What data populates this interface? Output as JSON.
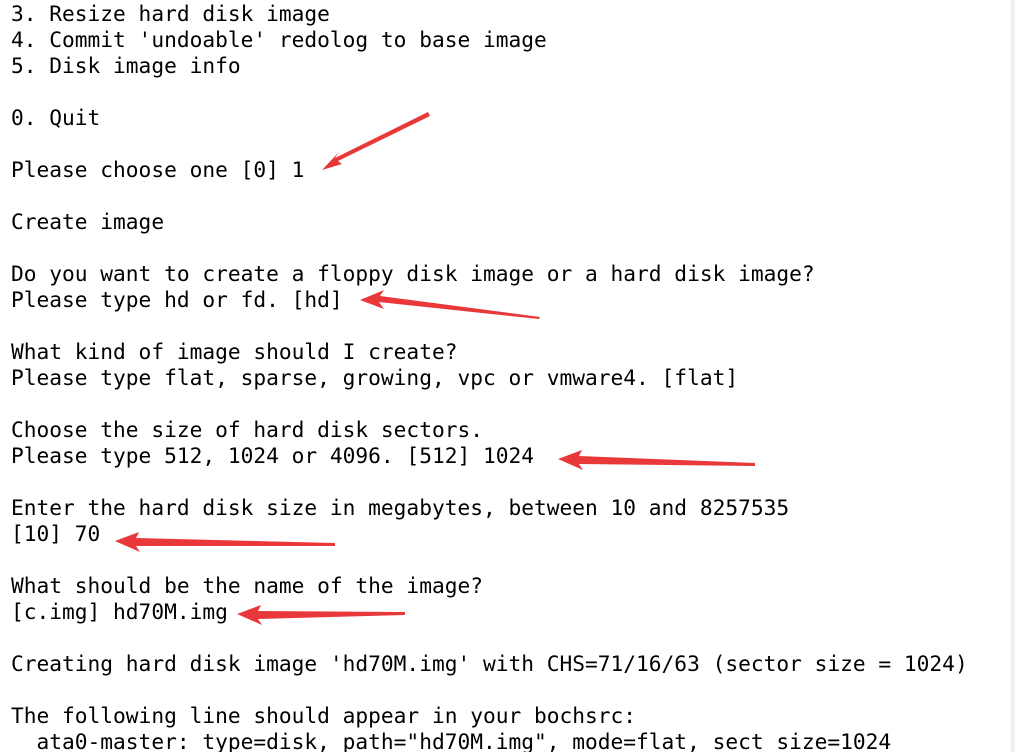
{
  "terminal": {
    "lines": [
      "3. Resize hard disk image",
      "4. Commit 'undoable' redolog to base image",
      "5. Disk image info",
      "",
      "0. Quit",
      "",
      "Please choose one [0] 1",
      "",
      "Create image",
      "",
      "Do you want to create a floppy disk image or a hard disk image?",
      "Please type hd or fd. [hd]",
      "",
      "What kind of image should I create?",
      "Please type flat, sparse, growing, vpc or vmware4. [flat]",
      "",
      "Choose the size of hard disk sectors.",
      "Please type 512, 1024 or 4096. [512] 1024",
      "",
      "Enter the hard disk size in megabytes, between 10 and 8257535",
      "[10] 70",
      "",
      "What should be the name of the image?",
      "[c.img] hd70M.img",
      "",
      "Creating hard disk image 'hd70M.img' with CHS=71/16/63 (sector size = 1024)",
      "",
      "The following line should appear in your bochsrc:",
      "  ata0-master: type=disk, path=\"hd70M.img\", mode=flat, sect_size=1024"
    ]
  },
  "annotations": {
    "arrow_color": "#e8383a",
    "arrows": [
      {
        "target": "Please choose one [0] 1"
      },
      {
        "target": "Please type hd or fd. [hd]"
      },
      {
        "target": "Please type 512, 1024 or 4096. [512] 1024"
      },
      {
        "target": "[10] 70"
      },
      {
        "target": "[c.img] hd70M.img"
      }
    ]
  }
}
